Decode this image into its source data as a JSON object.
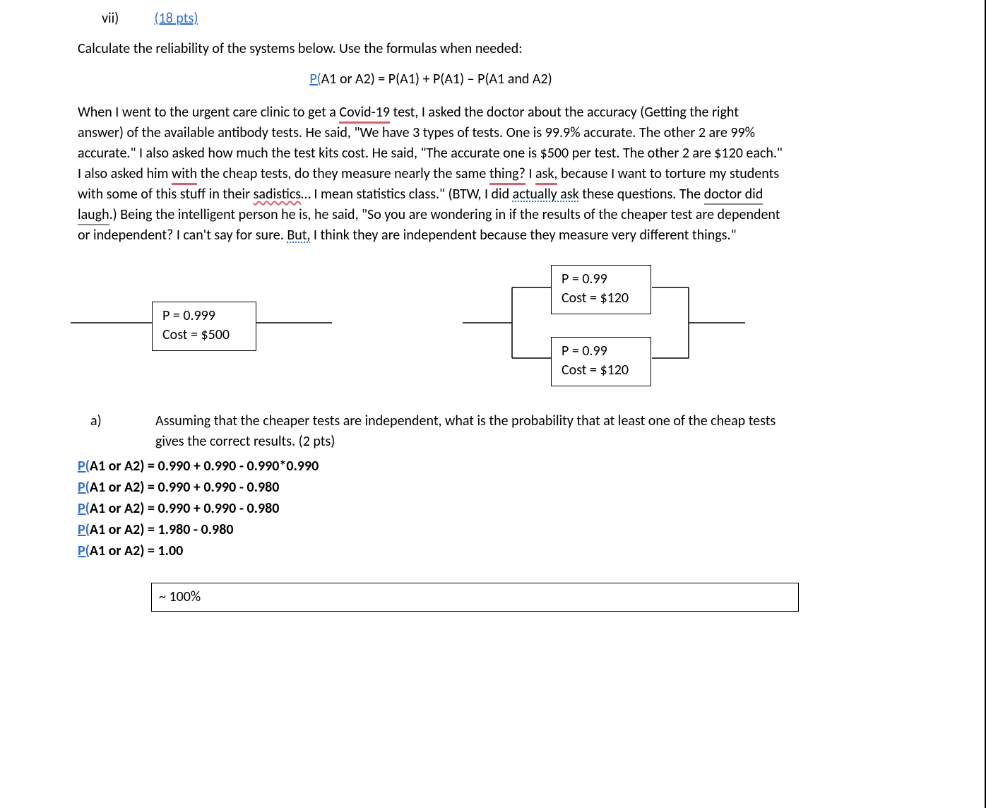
{
  "heading": {
    "number": "vii)",
    "points": "(18  pts)"
  },
  "intro": "Calculate the reliability of the systems below. Use the formulas when needed:",
  "formula": {
    "p": "P(",
    "rest": "A1 or A2) = P(A1) + P(A1) – P(A1 and A2)"
  },
  "story": {
    "t1": "When I went to the urgent care clinic to get a ",
    "covid": "Covid-19",
    "t2": " test, I asked the doctor about the accuracy (Getting the right answer) of the available antibody tests. He said, \"We have 3 types of tests. One is 99.9% accurate. The other 2 are 99% accurate.\" I also asked how much the test kits cost. He said, \"The accurate one is $500 per test. The other 2 are $120 each.\"  I also asked him ",
    "with": "with",
    "t3": " the cheap tests, do they measure nearly the same ",
    "thing": "thing?",
    "t4": " I ",
    "ask": "ask,",
    "t5": " because I want to torture my students with some of this stuff in their ",
    "sadistics": "sadistics",
    "t6": "… I mean statistics class.\" (BTW, I did ",
    "actually_ask": "actually ask",
    "t7": " these questions. The ",
    "doctor_laugh": "doctor did laugh",
    "t8": ".) Being the intelligent person he is, he said, \"So you are wondering in if the results of the cheaper test are dependent or independent? I can't say for sure. ",
    "but": "But,",
    "t9": " I think they are independent because they measure very different things.\""
  },
  "diagram": {
    "box1_p": "P = 0.999",
    "box1_cost": "Cost = $500",
    "box2_p": "P = 0.99",
    "box2_cost": "Cost = $120",
    "box3_p": "P = 0.99",
    "box3_cost": "Cost = $120"
  },
  "part_a": {
    "marker": "a)",
    "q": "Assuming that the cheaper tests are independent, what is the probability that at least one of the cheap tests gives the correct results. (2 pts)",
    "lines": {
      "l1a": "P(",
      "l1b": "A1 or A2) = 0.990 + 0.990 - 0.990*0.990",
      "l2a": "P(",
      "l2b": "A1 or A2) = 0.990 + 0.990 - 0.980",
      "l3a": "P(",
      "l3b": "A1 or A2) = 0.990 + 0.990 - 0.980",
      "l4a": "P(",
      "l4b": "A1 or A2) = 1.980 - 0.980",
      "l5a": "P(",
      "l5b": "A1 or A2) = 1.00"
    },
    "answer": "~ 100%"
  }
}
